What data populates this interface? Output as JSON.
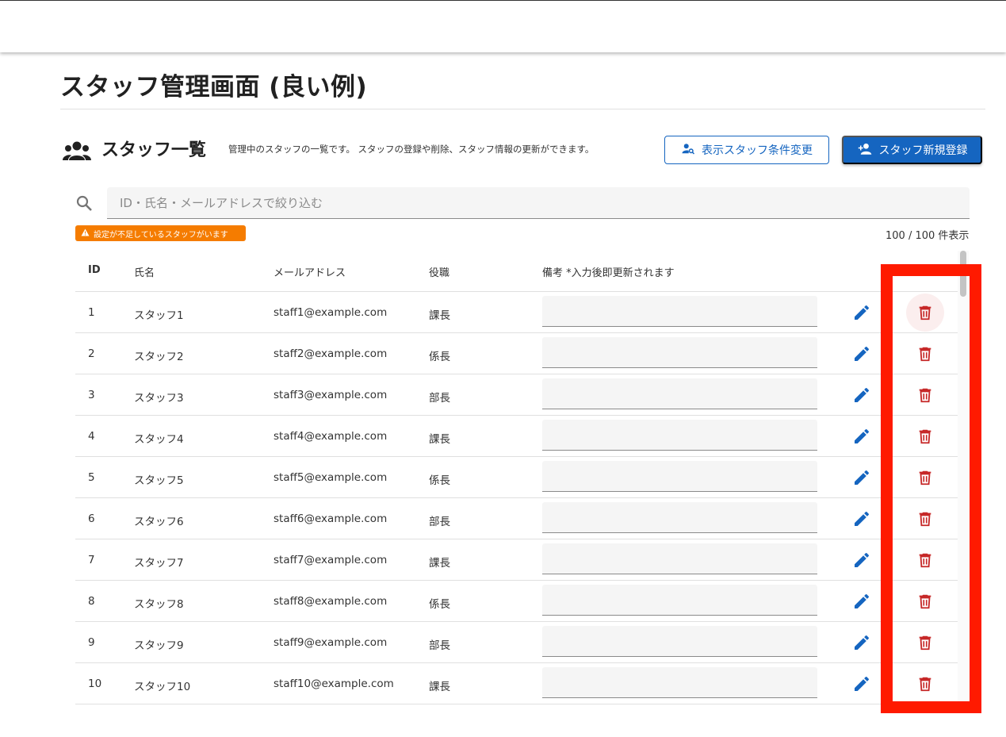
{
  "page": {
    "title": "スタッフ管理画面 (良い例)"
  },
  "section": {
    "icon": "people-icon",
    "title": "スタッフ一覧",
    "description": "管理中のスタッフの一覧です。 スタッフの登録や削除、スタッフ情報の更新ができます。"
  },
  "toolbar": {
    "filter_button": {
      "label": "表示スタッフ条件変更",
      "icon": "person-search-icon"
    },
    "add_button": {
      "label": "スタッフ新規登録",
      "icon": "person-add-icon"
    }
  },
  "search": {
    "placeholder": "ID・氏名・メールアドレスで絞り込む",
    "value": ""
  },
  "warning_badge": "設定が不足しているスタッフがいます",
  "count_text": "100 / 100 件表示",
  "table": {
    "headers": {
      "id": "ID",
      "name": "氏名",
      "email": "メールアドレス",
      "role": "役職",
      "note": "備考 *入力後即更新されます"
    },
    "rows": [
      {
        "id": "1",
        "name": "スタッフ1",
        "email": "staff1@example.com",
        "role": "課長",
        "note": ""
      },
      {
        "id": "2",
        "name": "スタッフ2",
        "email": "staff2@example.com",
        "role": "係長",
        "note": ""
      },
      {
        "id": "3",
        "name": "スタッフ3",
        "email": "staff3@example.com",
        "role": "部長",
        "note": ""
      },
      {
        "id": "4",
        "name": "スタッフ4",
        "email": "staff4@example.com",
        "role": "課長",
        "note": ""
      },
      {
        "id": "5",
        "name": "スタッフ5",
        "email": "staff5@example.com",
        "role": "係長",
        "note": ""
      },
      {
        "id": "6",
        "name": "スタッフ6",
        "email": "staff6@example.com",
        "role": "部長",
        "note": ""
      },
      {
        "id": "7",
        "name": "スタッフ7",
        "email": "staff7@example.com",
        "role": "課長",
        "note": ""
      },
      {
        "id": "8",
        "name": "スタッフ8",
        "email": "staff8@example.com",
        "role": "係長",
        "note": ""
      },
      {
        "id": "9",
        "name": "スタッフ9",
        "email": "staff9@example.com",
        "role": "部長",
        "note": ""
      },
      {
        "id": "10",
        "name": "スタッフ10",
        "email": "staff10@example.com",
        "role": "課長",
        "note": ""
      }
    ],
    "row_icons": {
      "edit": "pencil-icon",
      "delete": "trash-icon"
    }
  },
  "colors": {
    "primary": "#1565c0",
    "delete": "#c62828",
    "warning": "#f57c00",
    "highlight": "#ff1a00"
  }
}
